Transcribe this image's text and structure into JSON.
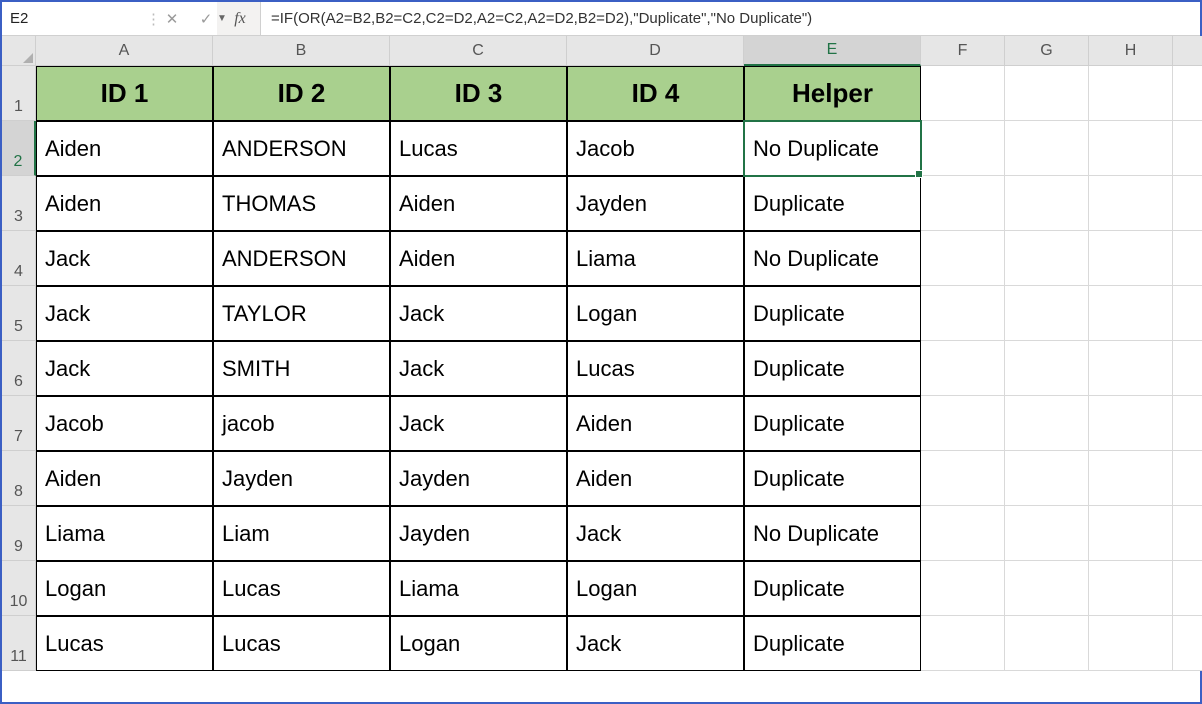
{
  "name_box": {
    "value": "E2"
  },
  "formula_bar": {
    "fx_label": "fx",
    "formula": "=IF(OR(A2=B2,B2=C2,C2=D2,A2=C2,A2=D2,B2=D2),\"Duplicate\",\"No Duplicate\")"
  },
  "columns": [
    "A",
    "B",
    "C",
    "D",
    "E",
    "F",
    "G",
    "H",
    ""
  ],
  "active_column_index": 4,
  "row_labels": [
    "1",
    "2",
    "3",
    "4",
    "5",
    "6",
    "7",
    "8",
    "9",
    "10",
    "11"
  ],
  "active_row_index": 1,
  "headers": [
    "ID 1",
    "ID 2",
    "ID 3",
    "ID 4",
    "Helper"
  ],
  "rows": [
    {
      "a": "Aiden",
      "b": "ANDERSON",
      "c": "Lucas",
      "d": "Jacob",
      "e": "No Duplicate"
    },
    {
      "a": "Aiden",
      "b": "THOMAS",
      "c": "Aiden",
      "d": "Jayden",
      "e": "Duplicate"
    },
    {
      "a": "Jack",
      "b": "ANDERSON",
      "c": "Aiden",
      "d": "Liama",
      "e": "No Duplicate"
    },
    {
      "a": "Jack",
      "b": "TAYLOR",
      "c": "Jack",
      "d": "Logan",
      "e": "Duplicate"
    },
    {
      "a": "Jack",
      "b": "SMITH",
      "c": "Jack",
      "d": "Lucas",
      "e": "Duplicate"
    },
    {
      "a": "Jacob",
      "b": "jacob",
      "c": "Jack",
      "d": "Aiden",
      "e": "Duplicate"
    },
    {
      "a": "Aiden",
      "b": "Jayden",
      "c": "Jayden",
      "d": "Aiden",
      "e": "Duplicate"
    },
    {
      "a": "Liama",
      "b": "Liam",
      "c": "Jayden",
      "d": "Jack",
      "e": "No Duplicate"
    },
    {
      "a": "Logan",
      "b": "Lucas",
      "c": "Liama",
      "d": "Logan",
      "e": "Duplicate"
    },
    {
      "a": "Lucas",
      "b": "Lucas",
      "c": "Logan",
      "d": "Jack",
      "e": "Duplicate"
    }
  ]
}
